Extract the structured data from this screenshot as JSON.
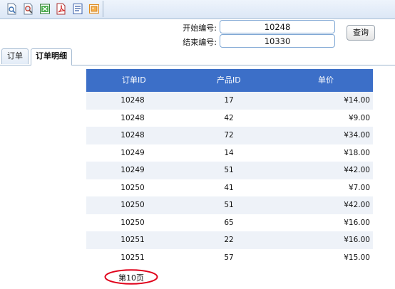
{
  "toolbar": {
    "icons": [
      "print-preview-icon",
      "zoom-icon",
      "excel-export-icon",
      "pdf-export-icon",
      "word-export-icon",
      "image-export-icon"
    ]
  },
  "search": {
    "start_label": "开始编号:",
    "start_value": "10248",
    "end_label": "结束编号:",
    "end_value": "10330",
    "query_label": "查询"
  },
  "tabs": [
    {
      "label": "订单",
      "active": false
    },
    {
      "label": "订单明细",
      "active": true
    }
  ],
  "table": {
    "headers": [
      "订单ID",
      "产品ID",
      "单价"
    ],
    "rows": [
      [
        "10248",
        "17",
        "¥14.00"
      ],
      [
        "10248",
        "42",
        "¥9.00"
      ],
      [
        "10248",
        "72",
        "¥34.00"
      ],
      [
        "10249",
        "14",
        "¥18.00"
      ],
      [
        "10249",
        "51",
        "¥42.00"
      ],
      [
        "10250",
        "41",
        "¥7.00"
      ],
      [
        "10250",
        "51",
        "¥42.00"
      ],
      [
        "10250",
        "65",
        "¥16.00"
      ],
      [
        "10251",
        "22",
        "¥16.00"
      ],
      [
        "10251",
        "57",
        "¥15.00"
      ]
    ]
  },
  "pager": {
    "label": "第10页"
  },
  "colors": {
    "header_bg": "#3c6fc8",
    "alt_row": "#eef2f8",
    "highlight": "#e0001a"
  }
}
